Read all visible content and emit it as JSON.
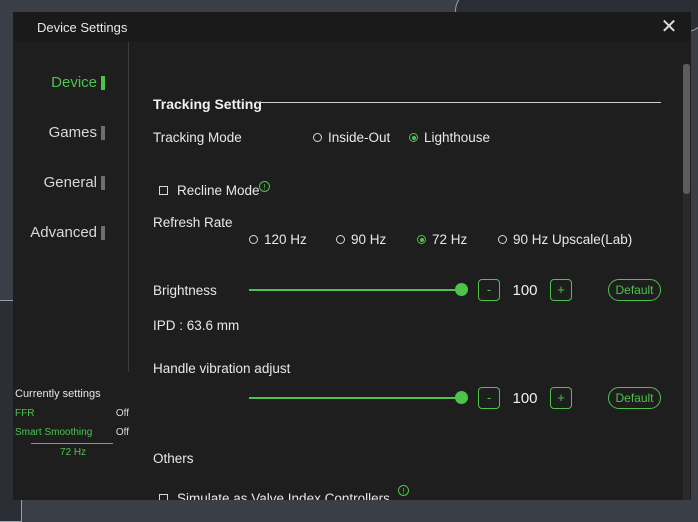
{
  "window": {
    "title": "Device Settings",
    "close_symbol": "✕"
  },
  "sidebar": {
    "items": [
      {
        "label": "Device",
        "active": true
      },
      {
        "label": "Games",
        "active": false
      },
      {
        "label": "General",
        "active": false
      },
      {
        "label": "Advanced",
        "active": false
      }
    ]
  },
  "current_settings": {
    "title": "Currently settings",
    "rows": [
      {
        "name": "FFR",
        "value": "Off"
      },
      {
        "name": "Smart Smoothing",
        "value": "Off"
      }
    ],
    "refresh": "72 Hz"
  },
  "tracking": {
    "section_title": "Tracking Setting",
    "mode_label": "Tracking Mode",
    "modes": [
      {
        "label": "Inside-Out",
        "selected": false
      },
      {
        "label": "Lighthouse",
        "selected": true
      }
    ]
  },
  "recline": {
    "label": "Recline Mode",
    "checked": false,
    "info_symbol": "!"
  },
  "refresh": {
    "label": "Refresh Rate",
    "options": [
      {
        "label": "120 Hz",
        "selected": false
      },
      {
        "label": "90 Hz",
        "selected": false
      },
      {
        "label": "72 Hz",
        "selected": true
      },
      {
        "label": "90 Hz Upscale(Lab)",
        "selected": false
      }
    ]
  },
  "brightness": {
    "label": "Brightness",
    "value": "100",
    "level_percent": 100,
    "minus": "-",
    "plus": "+",
    "default_label": "Default"
  },
  "ipd": {
    "text": "IPD : 63.6 mm"
  },
  "vibration": {
    "label": "Handle vibration adjust",
    "value": "100",
    "level_percent": 100,
    "minus": "-",
    "plus": "+",
    "default_label": "Default"
  },
  "others": {
    "label": "Others",
    "simulate_label": "Simulate as Valve Index Controllers",
    "simulate_checked": false,
    "info_symbol": "!"
  },
  "colors": {
    "accent": "#4cc44c",
    "background": "#1e1e1e"
  }
}
